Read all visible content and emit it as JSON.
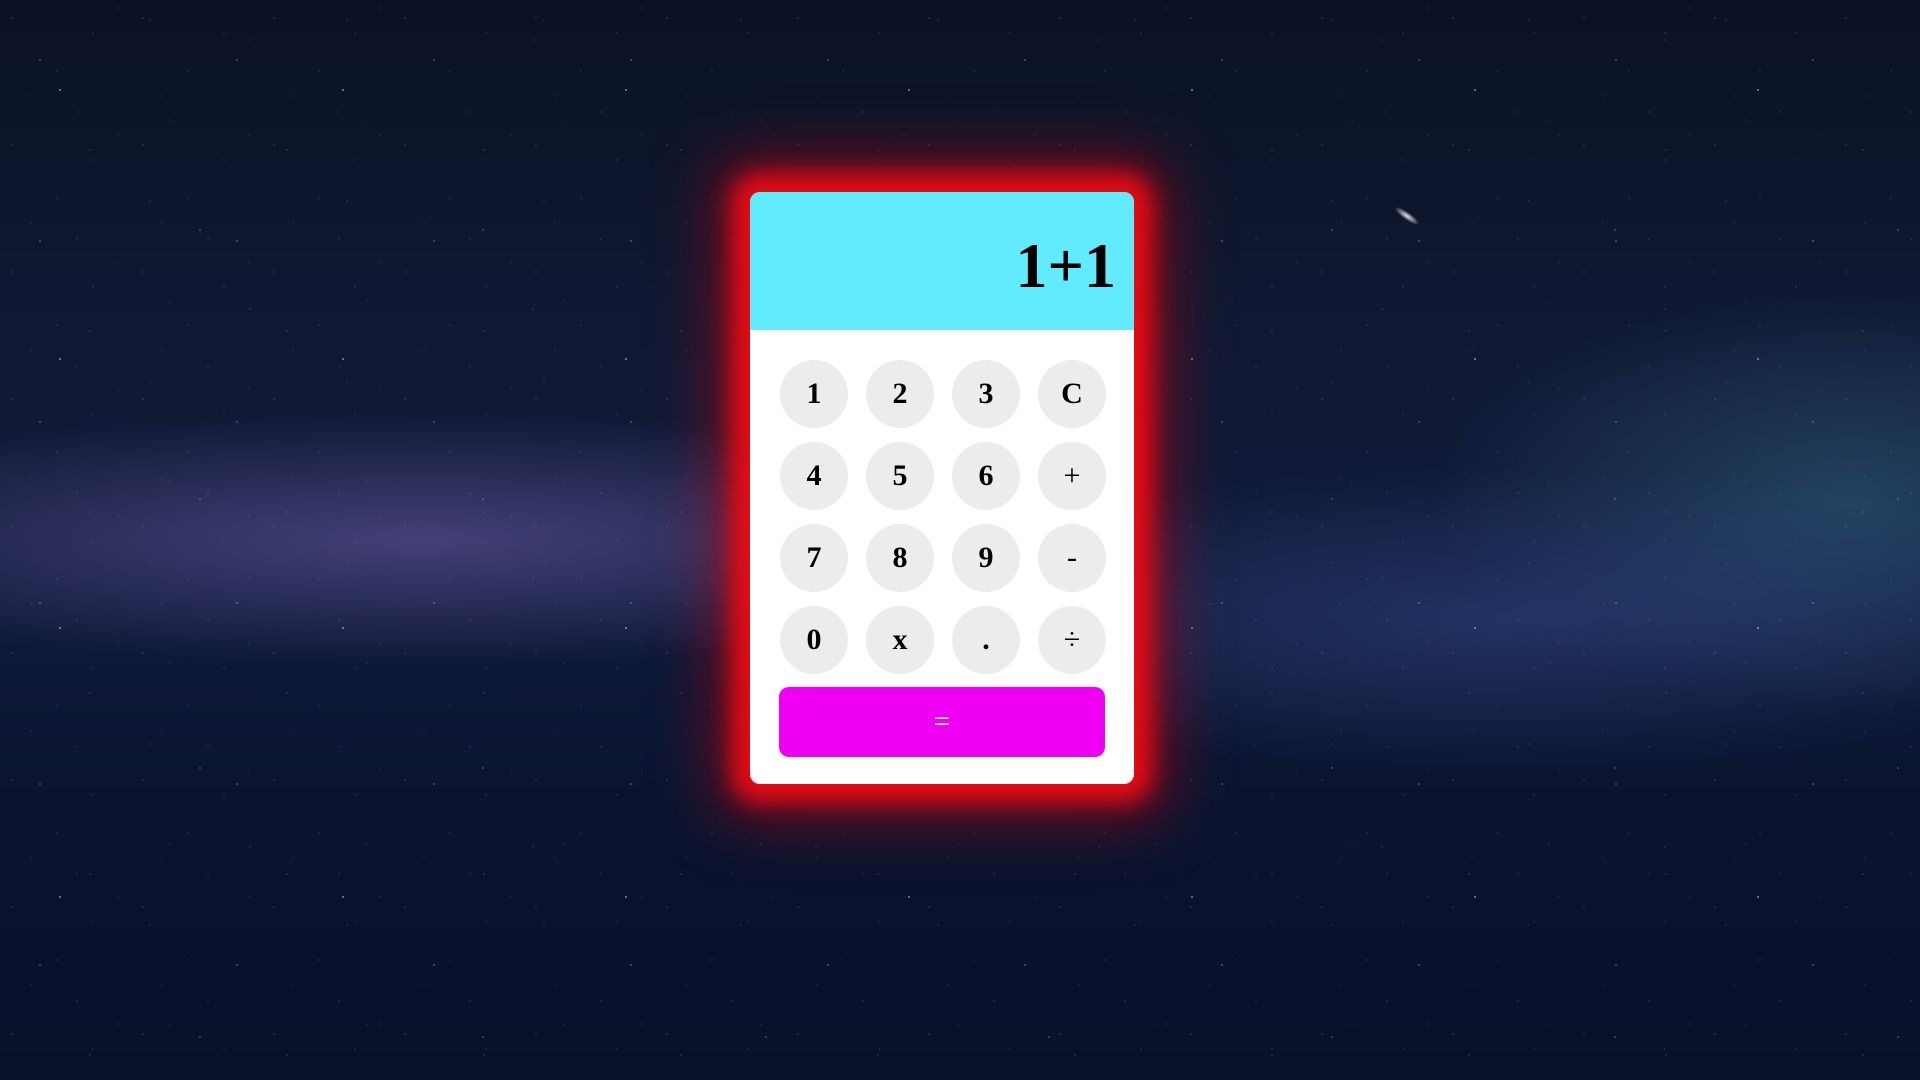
{
  "calculator": {
    "display": "1+1",
    "keys": {
      "k1": "1",
      "k2": "2",
      "k3": "3",
      "clear": "C",
      "k4": "4",
      "k5": "5",
      "k6": "6",
      "plus": "+",
      "k7": "7",
      "k8": "8",
      "k9": "9",
      "minus": "-",
      "k0": "0",
      "multiply": "x",
      "decimal": ".",
      "divide": "÷"
    },
    "equals": "="
  },
  "colors": {
    "display_bg": "#62ebfc",
    "key_bg": "#ececec",
    "equals_bg": "#ef00f3",
    "glow": "#eb0c14",
    "background": "#0f1a3a"
  }
}
